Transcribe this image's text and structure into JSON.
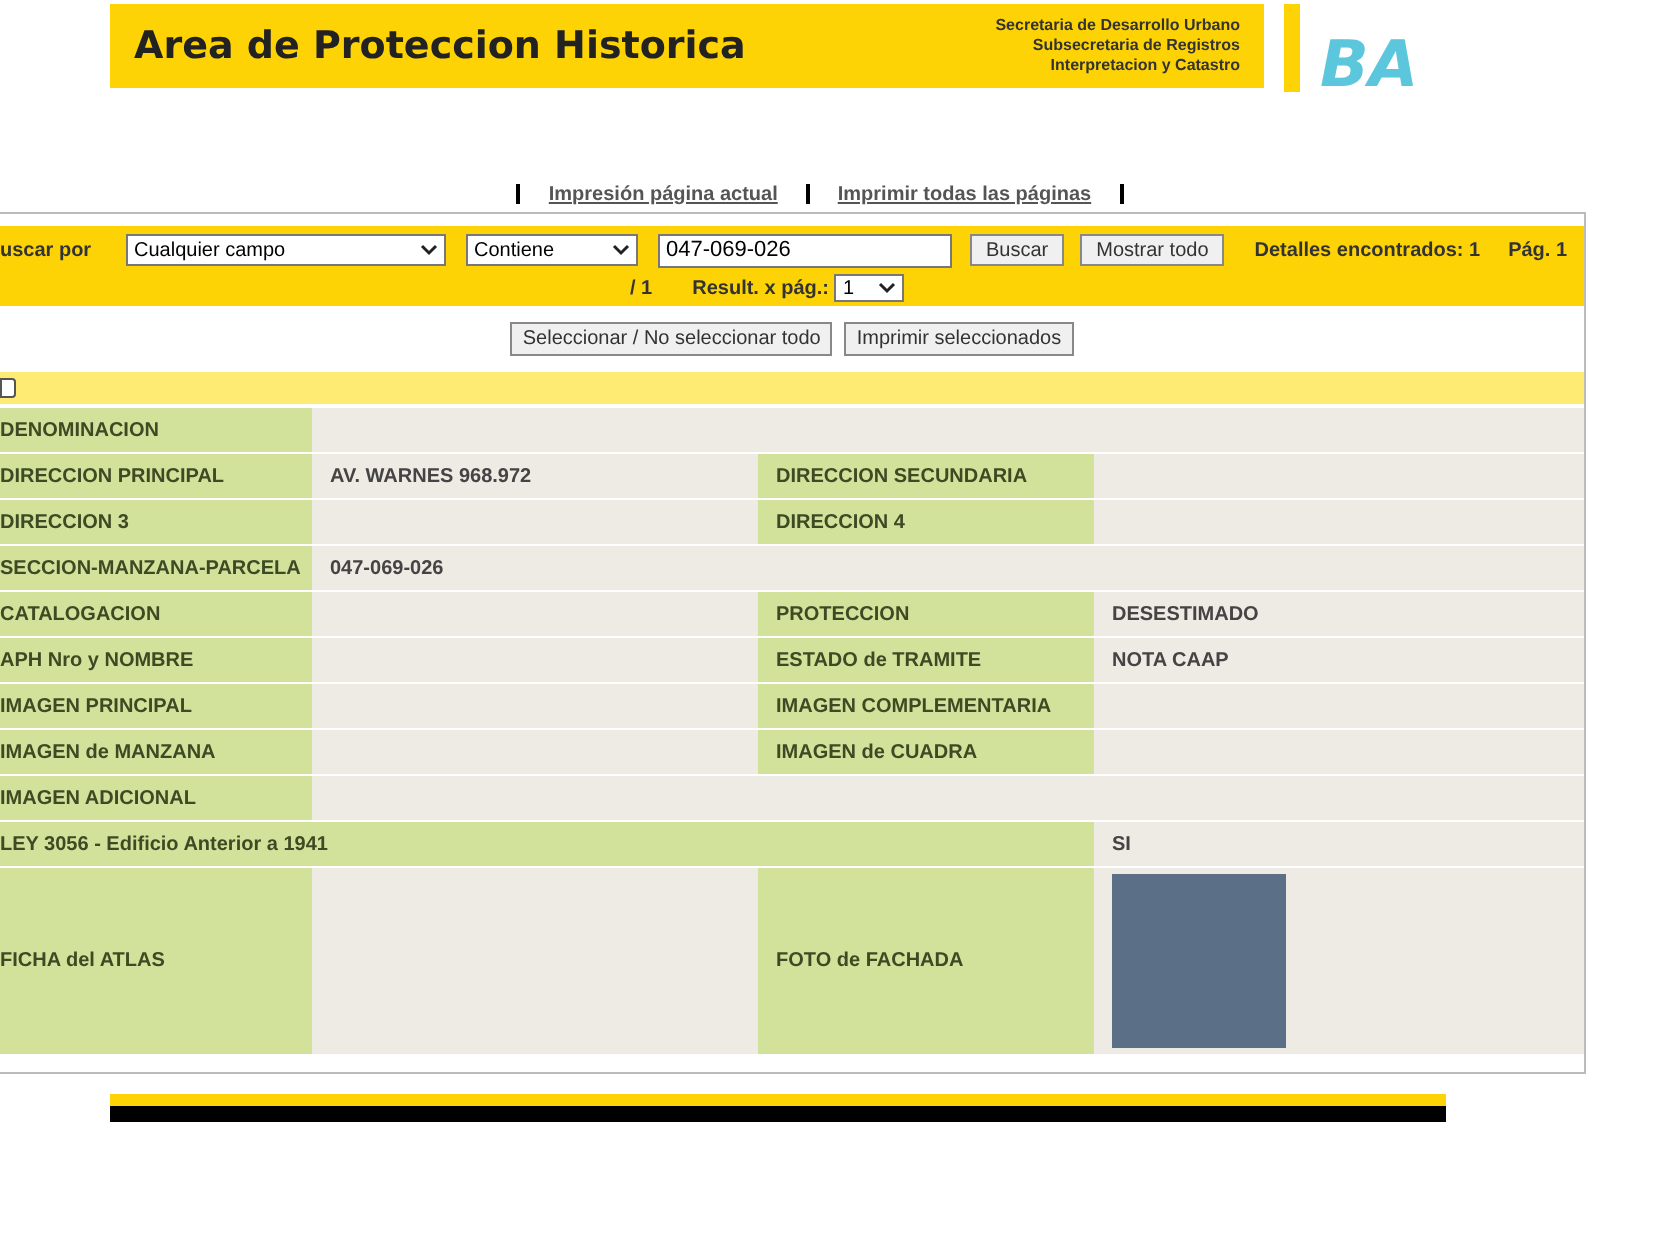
{
  "header": {
    "title": "Area de Proteccion Historica",
    "subtitle_lines": [
      "Secretaria de Desarrollo Urbano",
      "Subsecretaria de Registros",
      "Interpretacion y Catastro"
    ],
    "logo": "BA"
  },
  "print_links": [
    "Impresión página actual",
    "Imprimir todas las páginas"
  ],
  "search": {
    "label": "uscar por",
    "field": "Cualquier campo",
    "operator": "Contiene",
    "query": "047-069-026",
    "buttons": [
      "Buscar",
      "Mostrar todo"
    ],
    "found": "Detalles encontrados: 1",
    "page": "Pág. 1",
    "page_total": "/ 1",
    "per_page_label": "Result. x pág.:",
    "per_page": "1"
  },
  "actions": [
    "Seleccionar / No seleccionar todo",
    "Imprimir seleccionados"
  ],
  "select_all": {
    "checked": false
  },
  "rows": [
    {
      "kind": "full",
      "label": "DENOMINACION"
    },
    {
      "kind": "pair",
      "label": "DIRECCION PRINCIPAL",
      "value": "AV. WARNES 968.972",
      "label_2": "DIRECCION SECUNDARIA"
    },
    {
      "kind": "pair",
      "label": "DIRECCION 3",
      "label_2": "DIRECCION 4"
    },
    {
      "kind": "full",
      "label": "SECCION-MANZANA-PARCELA",
      "value": "047-069-026"
    },
    {
      "kind": "pair",
      "label": "CATALOGACION",
      "label_2": "PROTECCION",
      "value_2": "DESESTIMADO"
    },
    {
      "kind": "pair",
      "label": "APH Nro y NOMBRE",
      "label_2": "ESTADO de TRAMITE",
      "value_2": "NOTA CAAP"
    },
    {
      "kind": "pair",
      "label": "IMAGEN PRINCIPAL",
      "label_2": "IMAGEN COMPLEMENTARIA"
    },
    {
      "kind": "pair",
      "label": "IMAGEN de MANZANA",
      "label_2": "IMAGEN de CUADRA"
    },
    {
      "kind": "full",
      "label": "IMAGEN ADICIONAL"
    },
    {
      "kind": "wide",
      "label": "LEY 3056 - Edificio Anterior a 1941",
      "value_2": "SI"
    },
    {
      "kind": "photo",
      "label": "FICHA del ATLAS",
      "label_2": "FOTO de FACHADA"
    }
  ]
}
